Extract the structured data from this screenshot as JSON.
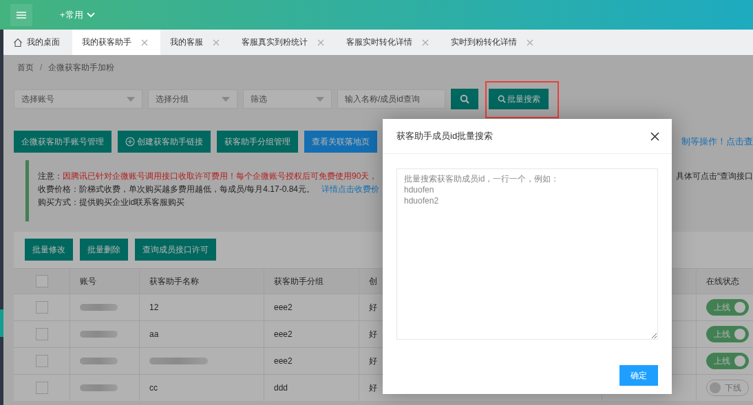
{
  "header": {
    "shortcut": "+常用"
  },
  "tabs": [
    {
      "label": "我的桌面",
      "kind": "home",
      "selected": false
    },
    {
      "label": "我的获客助手",
      "kind": "closable",
      "selected": true
    },
    {
      "label": "我的客服",
      "kind": "closable",
      "selected": false
    },
    {
      "label": "客服真实到粉统计",
      "kind": "closable",
      "selected": false
    },
    {
      "label": "客服实时转化详情",
      "kind": "closable",
      "selected": false
    },
    {
      "label": "实时到粉转化详情",
      "kind": "closable",
      "selected": false
    }
  ],
  "breadcrumb": {
    "items": [
      "首页",
      "企微获客助手加粉"
    ],
    "separator": "/"
  },
  "filters": {
    "selects": [
      "选择账号",
      "选择分组",
      "筛选"
    ],
    "search_placeholder": "输入名称/成员id查询",
    "batch_search": {
      "label": "批量搜索",
      "highlighted": true
    }
  },
  "actions": [
    {
      "label": "企微获客助手账号管理",
      "kind": "primary"
    },
    {
      "label": "创建获客助手链接",
      "kind": "add"
    },
    {
      "label": "获客助手分组管理",
      "kind": "primary"
    },
    {
      "label": "查看关联落地页",
      "kind": "blue"
    }
  ],
  "action_note": "制等操作！点击查",
  "notice": {
    "lines": [
      {
        "label": "注意：",
        "text": "因腾讯已针对企微账号调用接口收取许可费用！每个企微账号授权后可免费使用90天，",
        "kind": "warning",
        "right": "具体可点击“查询接口"
      },
      {
        "label": "收费价格：",
        "text": "阶梯式收费，单次购买越多费用越低，每成员/每月4.17-0.84元。",
        "kind": "plain",
        "link": "详情点击收费价"
      },
      {
        "label": "购买方式：",
        "text": "提供购买企业id联系客服购买",
        "kind": "plain"
      }
    ]
  },
  "table": {
    "buttons": [
      "批量修改",
      "批量删除",
      "查询成员接口许可"
    ],
    "header_checked": false,
    "columns": [
      "账号",
      "获客助手名称",
      "获客助手分组",
      "创",
      "在线状态"
    ],
    "rows": [
      {
        "checked": false,
        "account_redacted": true,
        "name": "12",
        "group": "eee2",
        "created": "好",
        "online": true,
        "status": "上线"
      },
      {
        "checked": false,
        "account_redacted": true,
        "name": "aa",
        "group": "eee2",
        "created": "好",
        "online": true,
        "status": "上线"
      },
      {
        "checked": false,
        "account_redacted": true,
        "name_redacted": true,
        "group": "eee2",
        "created": "好",
        "online": true,
        "status": "上线"
      },
      {
        "checked": false,
        "account_redacted": true,
        "name": "cc",
        "group": "ddd",
        "created": "好",
        "online": false,
        "status": "下线"
      }
    ]
  },
  "modal": {
    "title": "获客助手成员id批量搜索",
    "placeholder": "批量搜索获客助成员id，一行一个，例如：\nhduofen\nhduofen2",
    "confirm": "确定"
  }
}
